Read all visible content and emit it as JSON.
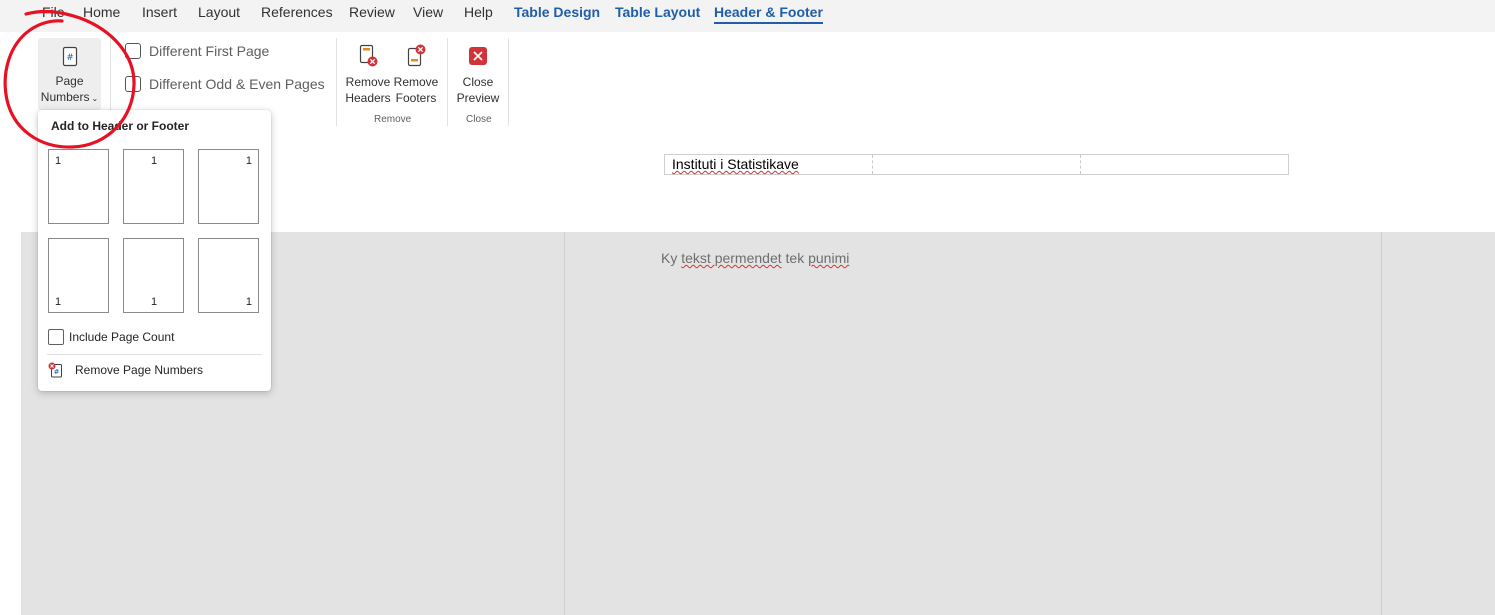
{
  "menu": {
    "tabs": [
      "File",
      "Home",
      "Insert",
      "Layout",
      "References",
      "Review",
      "View",
      "Help"
    ],
    "context_tabs": [
      "Table Design",
      "Table Layout",
      "Header & Footer"
    ],
    "active_tab": "Header & Footer"
  },
  "ribbon": {
    "page_numbers": {
      "line1": "Page",
      "line2": "Numbers",
      "icon": "page-number-icon"
    },
    "options": {
      "different_first_page": "Different First Page",
      "different_odd_even": "Different Odd & Even Pages"
    },
    "remove_group": {
      "remove_headers_line1": "Remove",
      "remove_headers_line2": "Headers",
      "remove_footers_line1": "Remove",
      "remove_footers_line2": "Footers",
      "label": "Remove"
    },
    "close_group": {
      "close_line1": "Close",
      "close_line2": "Preview",
      "label": "Close"
    }
  },
  "dropdown": {
    "title": "Add to Header or Footer",
    "positions": [
      {
        "place": "top-left",
        "num": "1"
      },
      {
        "place": "top-center",
        "num": "1"
      },
      {
        "place": "top-right",
        "num": "1"
      },
      {
        "place": "bottom-left",
        "num": "1"
      },
      {
        "place": "bottom-center",
        "num": "1"
      },
      {
        "place": "bottom-right",
        "num": "1"
      }
    ],
    "include_page_count": "Include Page Count",
    "remove_page_numbers": "Remove Page Numbers"
  },
  "document": {
    "header_text": "Instituti i Statistikave",
    "body_text": {
      "w1": "Ky",
      "w2": "tekst permendet",
      "w3": "tek",
      "w4": "punimi"
    }
  },
  "colors": {
    "accent": "#1f5ea8",
    "remove_red": "#d13438",
    "orange": "#e8891d",
    "annotation_red": "#e81123",
    "page_gray": "#e3e3e3"
  }
}
